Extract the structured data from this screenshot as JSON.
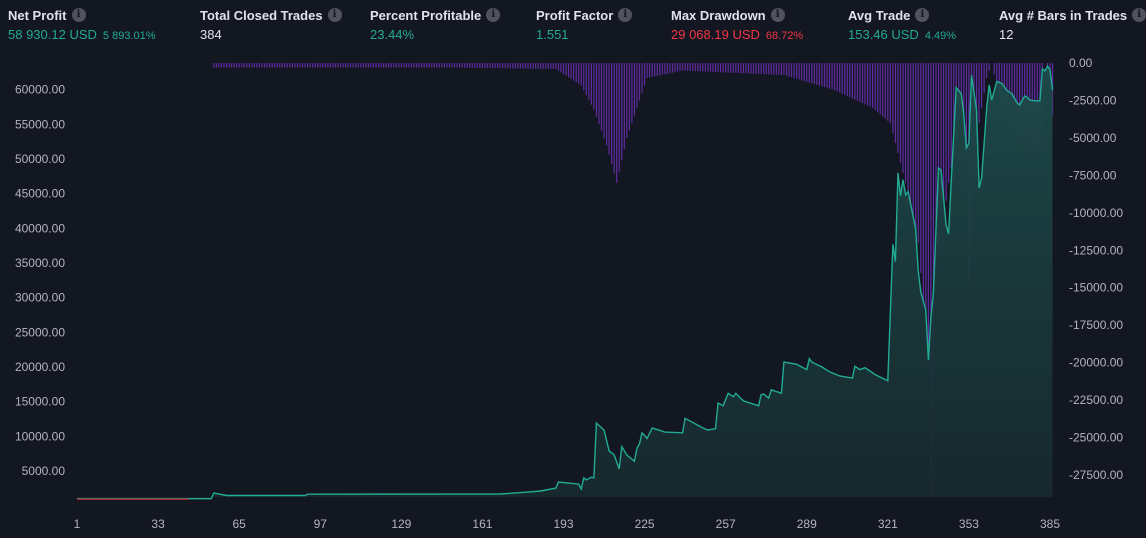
{
  "metrics": [
    {
      "label": "Net Profit",
      "value": "58 930.12 USD",
      "pct": "5 893.01%",
      "tone": "pos"
    },
    {
      "label": "Total Closed Trades",
      "value": "384",
      "pct": "",
      "tone": "neutral"
    },
    {
      "label": "Percent Profitable",
      "value": "23.44%",
      "pct": "",
      "tone": "pos"
    },
    {
      "label": "Profit Factor",
      "value": "1.551",
      "pct": "",
      "tone": "pos"
    },
    {
      "label": "Max Drawdown",
      "value": "29 068.19 USD",
      "pct": "68.72%",
      "tone": "neg"
    },
    {
      "label": "Avg Trade",
      "value": "153.46 USD",
      "pct": "4.49%",
      "tone": "pos"
    },
    {
      "label": "Avg # Bars in Trades",
      "value": "12",
      "pct": "",
      "tone": "neutral"
    }
  ],
  "info_icon": "info-icon",
  "chart_data": {
    "type": "area",
    "colors": {
      "background": "#131722",
      "equity": "#22ab94",
      "drawdown": "#6a2fb0",
      "benchmark": "#b2263a"
    },
    "grid": false,
    "x_ticks": [
      "1",
      "33",
      "65",
      "97",
      "129",
      "161",
      "193",
      "225",
      "257",
      "289",
      "321",
      "353",
      "385"
    ],
    "xlim": [
      1,
      388
    ],
    "left_axis": {
      "ylim": [
        1240,
        64000
      ],
      "tick_values": [
        5000,
        10000,
        15000,
        20000,
        25000,
        30000,
        35000,
        40000,
        45000,
        50000,
        55000,
        60000
      ],
      "tick_labels": [
        "5000.00",
        "10000.00",
        "15000.00",
        "20000.00",
        "25000.00",
        "30000.00",
        "35000.00",
        "40000.00",
        "45000.00",
        "50000.00",
        "55000.00",
        "60000.00"
      ]
    },
    "right_axis": {
      "ylim": [
        -28970,
        70
      ],
      "tick_values": [
        0,
        -2500,
        -5000,
        -7500,
        -10000,
        -12500,
        -15000,
        -17500,
        -20000,
        -22500,
        -25000,
        -27500
      ],
      "tick_labels": [
        "0.00",
        "-2500.00",
        "-5000.00",
        "-7500.00",
        "-10000.00",
        "-12500.00",
        "-15000.00",
        "-17500.00",
        "-20000.00",
        "-22500.00",
        "-25000.00",
        "-27500.00"
      ]
    },
    "equity": [
      [
        1,
        1000
      ],
      [
        54,
        1000
      ],
      [
        55,
        1800
      ],
      [
        60,
        1450
      ],
      [
        91,
        1450
      ],
      [
        92,
        1650
      ],
      [
        168,
        1670
      ],
      [
        179,
        1950
      ],
      [
        184,
        2100
      ],
      [
        190,
        2530
      ],
      [
        191,
        3400
      ],
      [
        199,
        3100
      ],
      [
        200,
        2400
      ],
      [
        201,
        4000
      ],
      [
        202,
        3700
      ],
      [
        204,
        4100
      ],
      [
        205,
        4000
      ],
      [
        206,
        11900
      ],
      [
        209,
        10900
      ],
      [
        211,
        7900
      ],
      [
        213,
        7300
      ],
      [
        215,
        5300
      ],
      [
        216,
        8500
      ],
      [
        218,
        7300
      ],
      [
        221,
        6400
      ],
      [
        222,
        8300
      ],
      [
        223,
        8900
      ],
      [
        224,
        10500
      ],
      [
        226,
        9700
      ],
      [
        228,
        11200
      ],
      [
        233,
        10600
      ],
      [
        240,
        10500
      ],
      [
        241,
        12600
      ],
      [
        248,
        11200
      ],
      [
        250,
        10900
      ],
      [
        253,
        11100
      ],
      [
        254,
        14800
      ],
      [
        256,
        14400
      ],
      [
        258,
        16200
      ],
      [
        260,
        15700
      ],
      [
        261,
        16200
      ],
      [
        264,
        15100
      ],
      [
        270,
        14400
      ],
      [
        271,
        16000
      ],
      [
        272,
        16100
      ],
      [
        274,
        15500
      ],
      [
        275,
        16700
      ],
      [
        279,
        16200
      ],
      [
        280,
        20700
      ],
      [
        285,
        20400
      ],
      [
        289,
        19600
      ],
      [
        290,
        21200
      ],
      [
        291,
        20700
      ],
      [
        295,
        20000
      ],
      [
        298,
        19300
      ],
      [
        302,
        18700
      ],
      [
        307,
        18400
      ],
      [
        308,
        20100
      ],
      [
        310,
        19600
      ],
      [
        312,
        19900
      ],
      [
        316,
        18900
      ],
      [
        321,
        18000
      ],
      [
        323,
        37700
      ],
      [
        324,
        35200
      ],
      [
        325,
        48000
      ],
      [
        326,
        44700
      ],
      [
        327,
        47000
      ],
      [
        328,
        44800
      ],
      [
        329,
        45300
      ],
      [
        332,
        39900
      ],
      [
        333,
        33900
      ],
      [
        334,
        30800
      ],
      [
        336,
        28200
      ],
      [
        337,
        21000
      ],
      [
        338,
        27200
      ],
      [
        339,
        30800
      ],
      [
        341,
        48700
      ],
      [
        342,
        48400
      ],
      [
        344,
        40500
      ],
      [
        345,
        39200
      ],
      [
        346,
        46700
      ],
      [
        348,
        60300
      ],
      [
        350,
        59400
      ],
      [
        351,
        56400
      ],
      [
        352,
        51600
      ],
      [
        353,
        52300
      ],
      [
        354,
        62100
      ],
      [
        356,
        57100
      ],
      [
        357,
        45800
      ],
      [
        358,
        47300
      ],
      [
        360,
        57400
      ],
      [
        361,
        60700
      ],
      [
        362,
        58500
      ],
      [
        364,
        61200
      ],
      [
        366,
        60900
      ],
      [
        368,
        59900
      ],
      [
        370,
        59400
      ],
      [
        372,
        58100
      ],
      [
        373,
        57800
      ],
      [
        375,
        59100
      ],
      [
        376,
        58900
      ],
      [
        377,
        58500
      ],
      [
        379,
        58400
      ],
      [
        381,
        58400
      ],
      [
        382,
        63000
      ],
      [
        383,
        62700
      ],
      [
        384,
        63400
      ],
      [
        385,
        62900
      ],
      [
        386,
        59930
      ]
    ],
    "drawdown": [
      [
        1,
        0
      ],
      [
        54,
        0
      ],
      [
        55,
        -300
      ],
      [
        150,
        -300
      ],
      [
        190,
        -400
      ],
      [
        200,
        -1500
      ],
      [
        205,
        -3100
      ],
      [
        210,
        -5500
      ],
      [
        214,
        -8000
      ],
      [
        218,
        -5000
      ],
      [
        222,
        -3000
      ],
      [
        226,
        -1000
      ],
      [
        240,
        -500
      ],
      [
        280,
        -800
      ],
      [
        300,
        -1800
      ],
      [
        315,
        -3000
      ],
      [
        322,
        -4000
      ],
      [
        328,
        -8000
      ],
      [
        333,
        -12000
      ],
      [
        337,
        -20000
      ],
      [
        338,
        -29000
      ],
      [
        340,
        -14000
      ],
      [
        345,
        -8000
      ],
      [
        350,
        -3000
      ],
      [
        352,
        -9000
      ],
      [
        353,
        -15000
      ],
      [
        356,
        -5000
      ],
      [
        360,
        -1000
      ],
      [
        362,
        0
      ],
      [
        366,
        -3000
      ],
      [
        372,
        -5000
      ],
      [
        378,
        -6000
      ],
      [
        382,
        -5500
      ],
      [
        383,
        0
      ],
      [
        385,
        -2000
      ],
      [
        386,
        -3500
      ]
    ],
    "benchmark": [
      [
        1,
        1000
      ],
      [
        45,
        1000
      ]
    ]
  }
}
